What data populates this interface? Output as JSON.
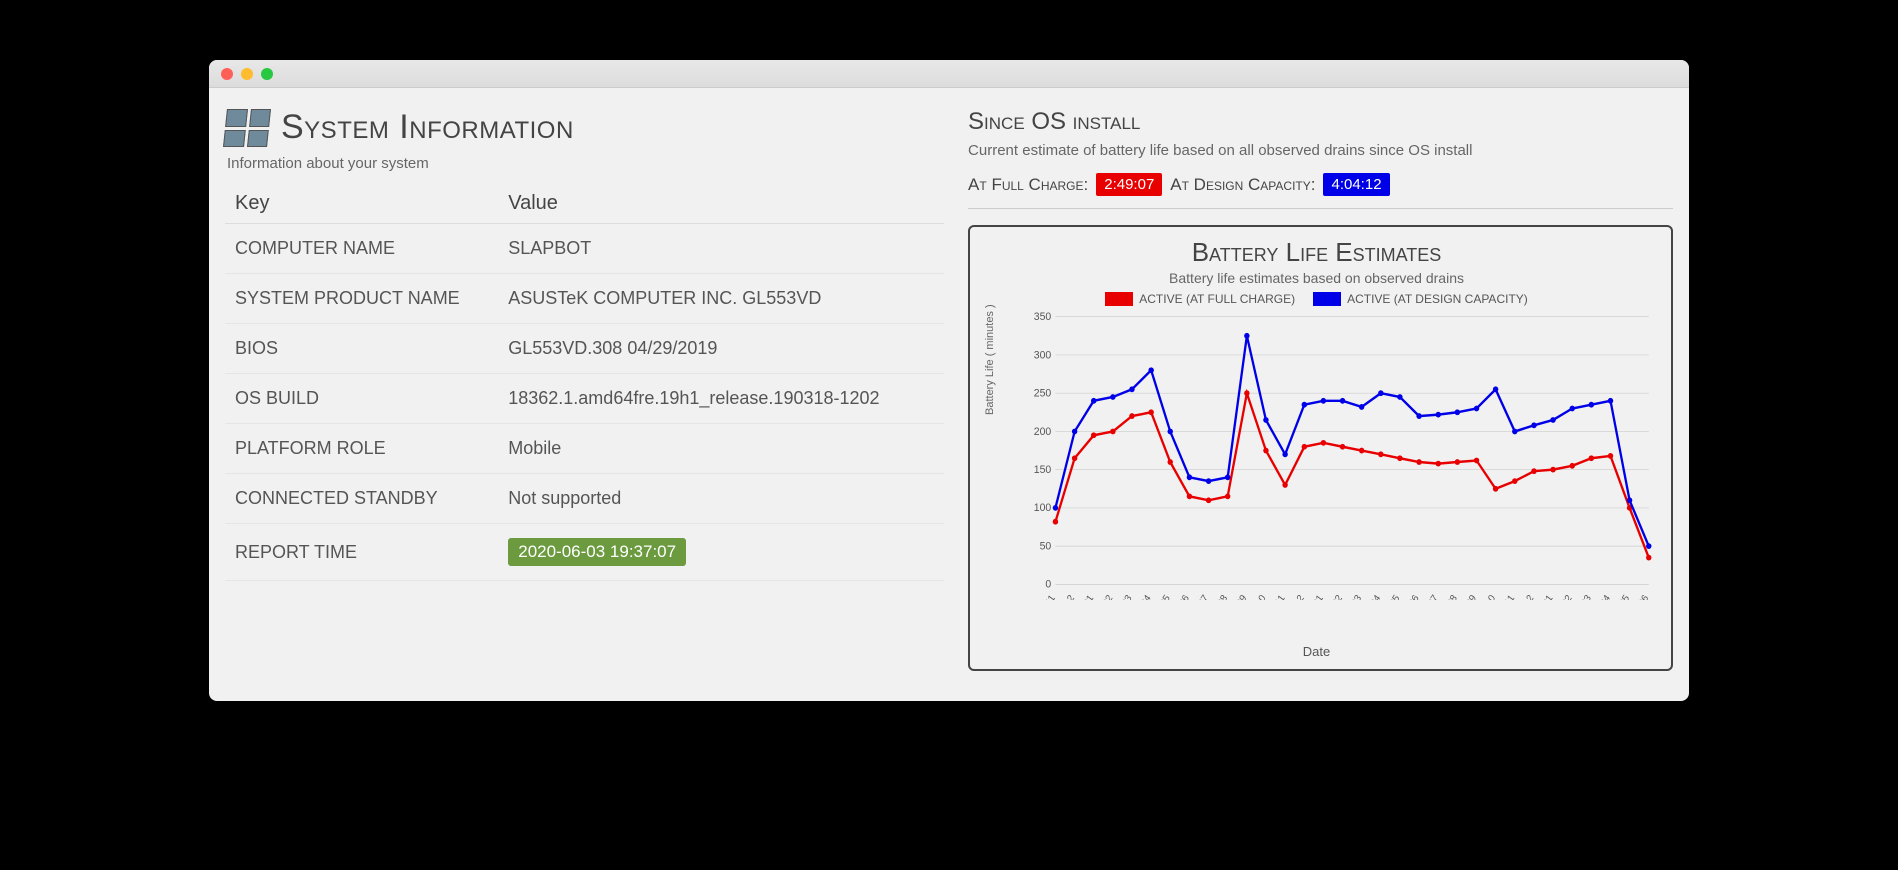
{
  "header": {
    "title": "System Information",
    "subtitle": "Information about your system"
  },
  "table": {
    "columns": [
      "Key",
      "Value"
    ],
    "rows": [
      {
        "key": "COMPUTER NAME",
        "value": "SLAPBOT"
      },
      {
        "key": "SYSTEM PRODUCT NAME",
        "value": "ASUSTeK COMPUTER INC. GL553VD"
      },
      {
        "key": "BIOS",
        "value": "GL553VD.308 04/29/2019"
      },
      {
        "key": "OS BUILD",
        "value": "18362.1.amd64fre.19h1_release.190318-1202"
      },
      {
        "key": "PLATFORM ROLE",
        "value": "Mobile"
      },
      {
        "key": "CONNECTED STANDBY",
        "value": "Not supported"
      },
      {
        "key": "REPORT TIME",
        "value": "2020-06-03 19:37:07",
        "badge": true
      }
    ]
  },
  "since": {
    "title": "Since OS install",
    "desc": "Current estimate of battery life based on all observed drains since OS install",
    "full_label": "At Full Charge:",
    "full_value": "2:49:07",
    "design_label": "At Design Capacity:",
    "design_value": "4:04:12"
  },
  "chart": {
    "title": "Battery Life Estimates",
    "subtitle": "Battery life estimates based on observed drains",
    "legend_active_full": "ACTIVE (AT FULL CHARGE)",
    "legend_active_design": "ACTIVE (AT DESIGN CAPACITY)",
    "xlabel": "Date",
    "ylabel": "Battery Life ( minutes )"
  },
  "chart_data": {
    "type": "line",
    "xlabel": "Date",
    "ylabel": "Battery Life ( minutes )",
    "ylim": [
      0,
      350
    ],
    "yticks": [
      0,
      50,
      100,
      150,
      200,
      250,
      300,
      350
    ],
    "categories": [
      "201711",
      "201712",
      "201801",
      "201802",
      "201803",
      "201804",
      "201805",
      "201806",
      "201807",
      "201808",
      "201809",
      "201810",
      "201811",
      "201812",
      "201901",
      "201902",
      "201903",
      "201904",
      "201905",
      "201906",
      "201907",
      "201908",
      "201909",
      "201910",
      "201911",
      "201912",
      "202001",
      "202002",
      "202003",
      "202004",
      "202005",
      "202006"
    ],
    "series": [
      {
        "name": "ACTIVE (AT FULL CHARGE)",
        "color": "#e80000",
        "values": [
          82,
          165,
          195,
          200,
          220,
          225,
          160,
          115,
          110,
          115,
          250,
          175,
          130,
          180,
          185,
          180,
          175,
          170,
          165,
          160,
          158,
          160,
          162,
          125,
          135,
          148,
          150,
          155,
          165,
          168,
          100,
          35
        ]
      },
      {
        "name": "ACTIVE (AT DESIGN CAPACITY)",
        "color": "#0000e8",
        "values": [
          100,
          200,
          240,
          245,
          255,
          280,
          200,
          140,
          135,
          140,
          325,
          215,
          170,
          235,
          240,
          240,
          232,
          250,
          245,
          220,
          222,
          225,
          230,
          255,
          200,
          208,
          215,
          230,
          235,
          240,
          110,
          50
        ]
      }
    ]
  }
}
